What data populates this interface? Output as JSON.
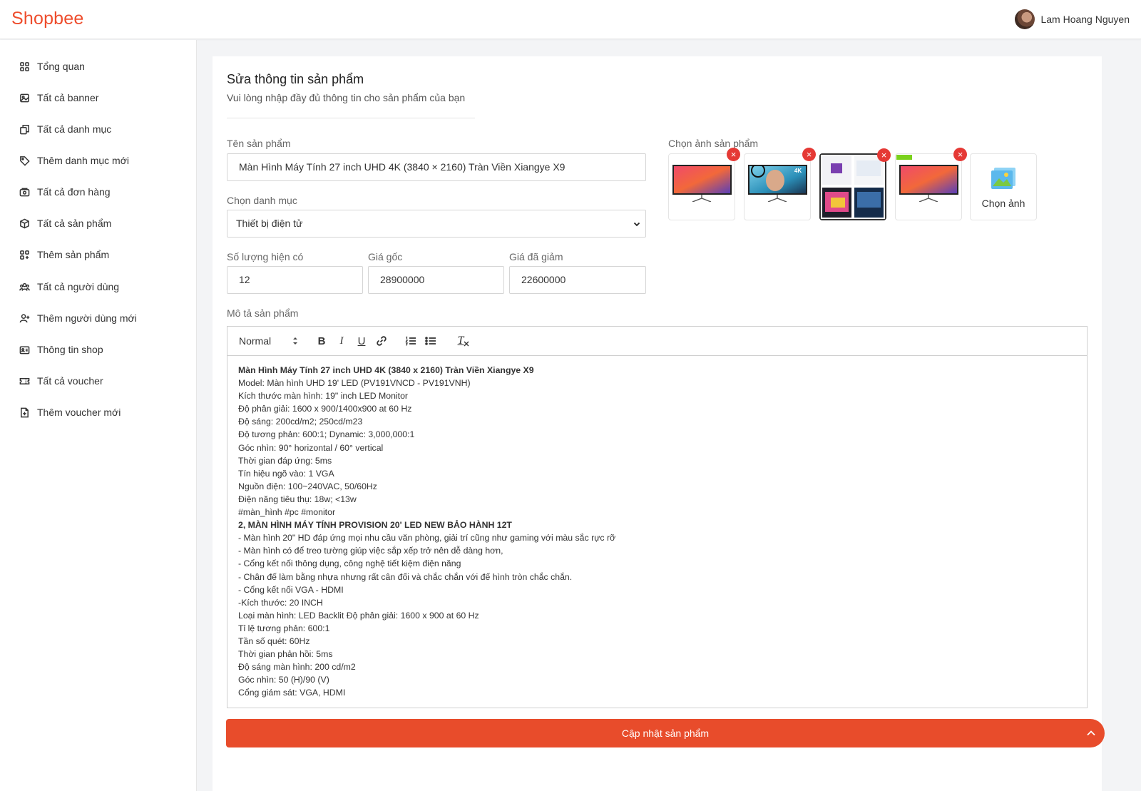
{
  "app": {
    "logo": "Shopbee",
    "user_name": "Lam Hoang Nguyen"
  },
  "sidebar": {
    "items": [
      {
        "label": "Tổng quan",
        "icon": "grid-icon"
      },
      {
        "label": "Tất cả banner",
        "icon": "image-icon"
      },
      {
        "label": "Tất cả danh mục",
        "icon": "copy-icon"
      },
      {
        "label": "Thêm danh mục mới",
        "icon": "tag-icon"
      },
      {
        "label": "Tất cả đơn hàng",
        "icon": "order-icon"
      },
      {
        "label": "Tất cả sản phẩm",
        "icon": "box-icon"
      },
      {
        "label": "Thêm sản phẩm",
        "icon": "grid-plus-icon"
      },
      {
        "label": "Tất cả người dùng",
        "icon": "users-icon"
      },
      {
        "label": "Thêm người dùng mới",
        "icon": "user-plus-icon"
      },
      {
        "label": "Thông tin shop",
        "icon": "shop-icon"
      },
      {
        "label": "Tất cả voucher",
        "icon": "ticket-icon"
      },
      {
        "label": "Thêm voucher mới",
        "icon": "file-plus-icon"
      }
    ]
  },
  "form": {
    "title": "Sửa thông tin sản phẩm",
    "subtitle": "Vui lòng nhập đầy đủ thông tin cho sản phẩm của bạn",
    "name_label": "Tên sản phẩm",
    "name_value": "Màn Hình Máy Tính 27 inch UHD 4K (3840 × 2160) Tràn Viền Xiangye X9",
    "category_label": "Chọn danh mục",
    "category_value": "Thiết bị điện tử",
    "quantity_label": "Số lượng hiện có",
    "quantity_value": "12",
    "price_label": "Giá gốc",
    "price_value": "28900000",
    "sale_label": "Giá đã giảm",
    "sale_value": "22600000",
    "images_label": "Chọn ảnh sản phẩm",
    "choose_image_label": "Chọn ảnh",
    "remove_symbol": "×",
    "description_label": "Mô tả sản phẩm",
    "submit_label": "Cập nhật sản phẩm"
  },
  "editor": {
    "format_value": "Normal",
    "bold_label": "B",
    "italic_label": "I",
    "underline_label": "U",
    "clean_label": "T",
    "lines": [
      {
        "text": "Màn Hình Máy Tính 27 inch UHD 4K (3840 x 2160) Tràn Viền Xiangye X9",
        "bold": true
      },
      {
        "text": "Model: Màn hình UHD 19' LED (PV191VNCD - PV191VNH)",
        "bold": false
      },
      {
        "text": "Kích thước màn hình: 19\" inch LED Monitor",
        "bold": false
      },
      {
        "text": "Độ phân giải: 1600 x 900/1400x900 at 60 Hz",
        "bold": false
      },
      {
        "text": "Độ sáng: 200cd/m2; 250cd/m23",
        "bold": false
      },
      {
        "text": "Độ tương phản: 600:1; Dynamic: 3,000,000:1",
        "bold": false
      },
      {
        "text": "Góc nhìn: 90° horizontal / 60° vertical",
        "bold": false
      },
      {
        "text": "Thời gian đáp ứng: 5ms",
        "bold": false
      },
      {
        "text": "Tín hiệu ngõ vào: 1 VGA",
        "bold": false
      },
      {
        "text": "Nguồn điện: 100~240VAC, 50/60Hz",
        "bold": false
      },
      {
        "text": "Điện năng tiêu thụ: 18w; <13w",
        "bold": false
      },
      {
        "text": "#màn_hình #pc #monitor",
        "bold": false
      },
      {
        "text": "2, MÀN HÌNH MÁY TÍNH PROVISION 20' LED NEW BẢO HÀNH 12T",
        "bold": true
      },
      {
        "text": "- Màn hình 20\" HD đáp ứng mọi nhu cầu văn phòng, giải trí cũng như gaming với màu sắc rực rỡ",
        "bold": false
      },
      {
        "text": "- Màn hình có để treo tường giúp việc sắp xếp trở nên dễ dàng hơn,",
        "bold": false
      },
      {
        "text": "- Cổng kết nối thông dụng, công nghệ tiết kiệm điện năng",
        "bold": false
      },
      {
        "text": "- Chân đế làm bằng nhựa nhưng rất cân đối và chắc chắn với đế hình tròn chắc chắn.",
        "bold": false
      },
      {
        "text": "- Cổng kết nối VGA - HDMI",
        "bold": false
      },
      {
        "text": "-Kích thước: 20 INCH",
        "bold": false
      },
      {
        "text": "Loại màn hình: LED Backlit Độ phân giải: 1600 x 900 at 60 Hz",
        "bold": false
      },
      {
        "text": "Tỉ lệ tương phản: 600:1",
        "bold": false
      },
      {
        "text": "Tần số quét: 60Hz",
        "bold": false
      },
      {
        "text": "Thời gian phản hồi: 5ms",
        "bold": false
      },
      {
        "text": "Độ sáng màn hình: 200 cd/m2",
        "bold": false
      },
      {
        "text": "Góc nhìn: 50 (H)/90 (V)",
        "bold": false
      },
      {
        "text": "Cổng giám sát: VGA, HDMI",
        "bold": false
      }
    ]
  },
  "colors": {
    "brand": "#ee4d2d",
    "button": "#e84c2b",
    "remove": "#e53935"
  }
}
